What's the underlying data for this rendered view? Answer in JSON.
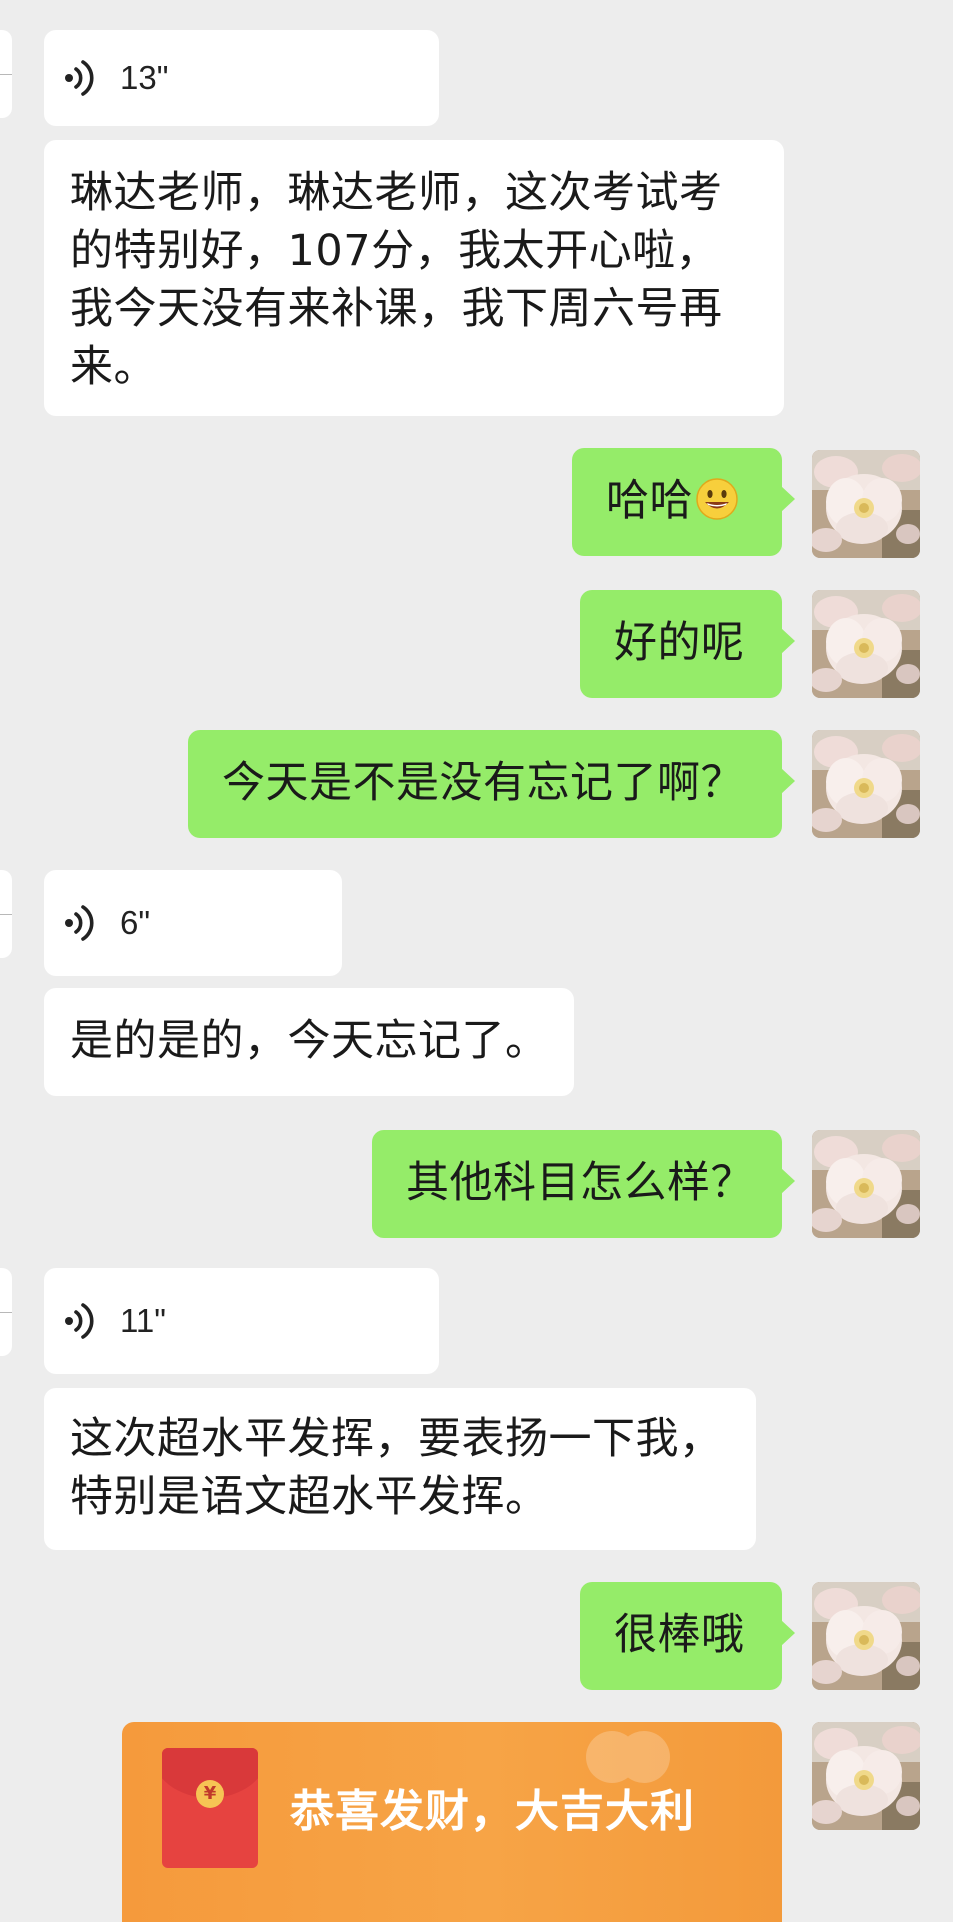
{
  "colors": {
    "background": "#ededed",
    "incoming_bubble": "#ffffff",
    "outgoing_bubble": "#95ec69",
    "red_packet": "#f7a446"
  },
  "messages": {
    "m1_voice": {
      "duration": "13\"",
      "icon": "voice-wave-icon"
    },
    "m2_text": "琳达老师，琳达老师，这次考试考\n的特别好，107分，我太开心啦，\n我今天没有来补课，我下周六号再\n来。",
    "m3_text": "哈哈",
    "m4_text": "好的呢",
    "m5_text": "今天是不是没有忘记了啊？",
    "m6_voice": {
      "duration": "6\"",
      "icon": "voice-wave-icon"
    },
    "m7_text": "是的是的，今天忘记了。",
    "m8_text": "其他科目怎么样？",
    "m9_voice": {
      "duration": "11\"",
      "icon": "voice-wave-icon"
    },
    "m10_text": "这次超水平发挥，要表扬一下我，\n特别是语文超水平发挥。",
    "m11_text": "很棒哦",
    "m12_red_packet": {
      "text": "恭喜发财，大吉大利",
      "coin": "¥"
    }
  }
}
